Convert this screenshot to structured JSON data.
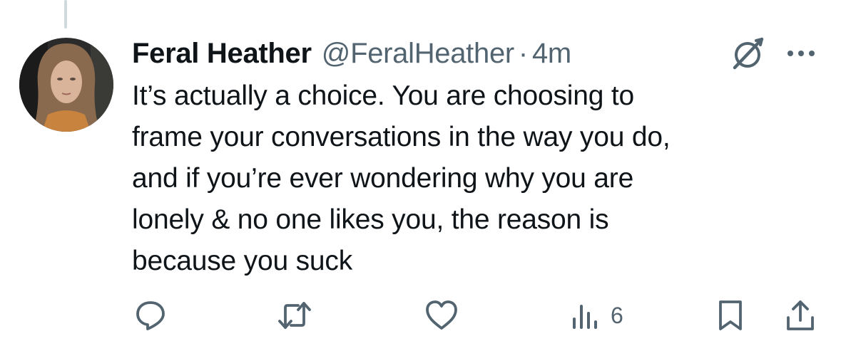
{
  "tweet": {
    "author": {
      "display_name": "Feral Heather",
      "handle": "@FeralHeather"
    },
    "separator": "·",
    "timestamp": "4m",
    "text_lines": [
      "It’s actually a choice. You are choosing to",
      "frame your conversations in the way you do,",
      "and if you’re ever wondering why you are",
      "lonely & no one likes you, the reason is",
      "because you suck"
    ]
  },
  "actions": {
    "views_count": "6"
  },
  "icons": {
    "reply": "reply-icon",
    "retweet": "retweet-icon",
    "like": "heart-icon",
    "views": "views-bar-chart-icon",
    "bookmark": "bookmark-icon",
    "share": "share-icon",
    "grok": "grok-icon",
    "more": "more-icon"
  },
  "colors": {
    "text_primary": "#0f1419",
    "text_secondary": "#536471",
    "thread_line": "#cfd9de",
    "background": "#ffffff"
  }
}
